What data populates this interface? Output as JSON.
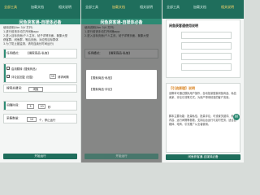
{
  "shared": {
    "tab_left": "全部工具",
    "tab_mid": "加载文档",
    "tab_right": "相关说明",
    "banner_title": "闲鱼获客通-自媒体必备",
    "start_button": "开始运行"
  },
  "panel1": {
    "notice_lines": [
      "使用说明(Ver 3)V 打开)",
      "1.进行前请手动打开闲鱼app",
      "2.进入目标页面(个人主页、帖子详情页面、聚集大型",
      "获客群、闲鱼群，等后页面，对应的目标群体",
      "3.为了防止被监测，请勿连续长时间运行)"
    ],
    "target_label": "任务模式:",
    "target_value": "【搜索商品·私信】",
    "options": [
      {
        "label": "启用跳转 (搜索商品)"
      },
      {
        "label": "评论区回复 (回复:",
        "value": "10",
        "suffix": "请求间隔"
      }
    ],
    "keyword_label": "搜索关键词:",
    "keyword_value": "闲鱼",
    "delay_label": "间隔时间:",
    "delay_min": "3",
    "delay_max": "10",
    "delay_unit": "秒",
    "count_label": "采集数量:",
    "count_value": "10",
    "count_unit": "个，停止运行"
  },
  "panel2": {
    "dialog_options": [
      "【搜索商品·私信】",
      "【搜索商品·评论】"
    ]
  },
  "panel3": {
    "card_title": "闲鱼获客通使用说明",
    "section_label": "【引流原理】说明",
    "paragraphs": [
      "该脚本可通过模拟用户操作，自动批量搜索闲鱼商品、私信卖家、评论引流等方式，为用户带来精准的客户流量。",
      "脚本主要功能：批量私信、批量评论，可设置关键词、私信内容、运行间隔等参数，支持后台运行与定时任务，适合自媒体、电商、引流推广从业者使用。"
    ],
    "footer_button": "闲鱼获客通-自媒体必备"
  }
}
